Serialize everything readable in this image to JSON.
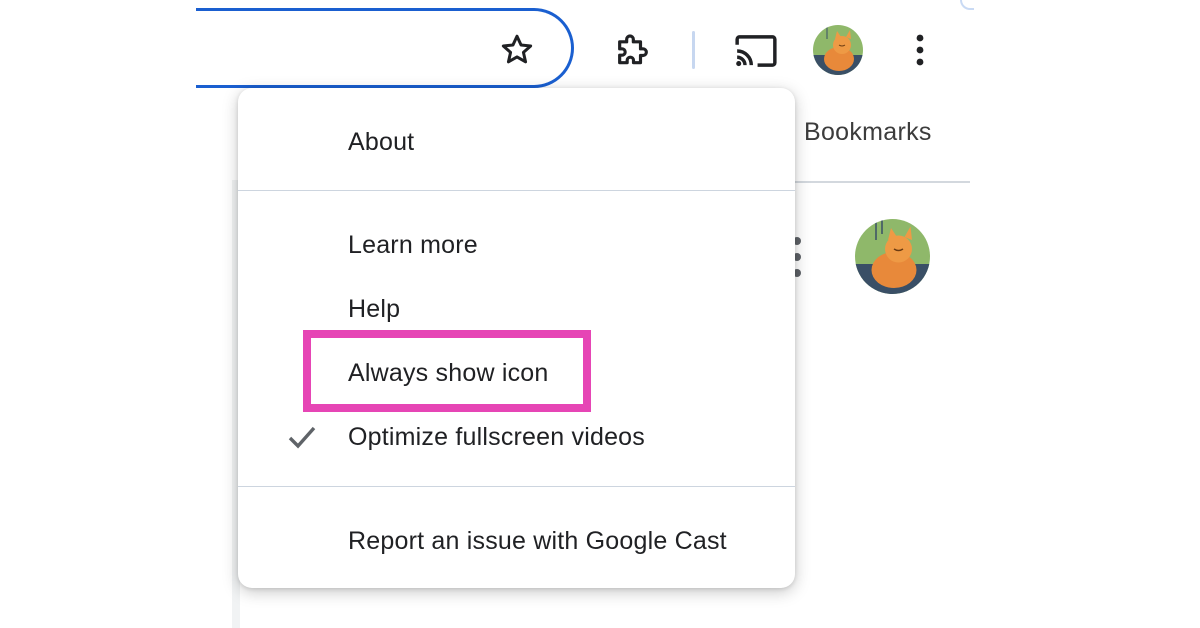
{
  "toolbar": {
    "icons": {
      "bookmark_star": "star-outline-icon",
      "extensions": "puzzle-piece-icon",
      "cast": "cast-icon",
      "profile": "profile-avatar-fox",
      "more": "three-dot-vertical-icon"
    },
    "omnibox_border_color": "#1a5fd0"
  },
  "page": {
    "bookmarks_label": "Bookmarks"
  },
  "cast_menu": {
    "items": [
      {
        "label": "About",
        "checked": false
      },
      {
        "label": "Learn more",
        "checked": false
      },
      {
        "label": "Help",
        "checked": false
      },
      {
        "label": "Always show icon",
        "checked": false,
        "highlighted": true
      },
      {
        "label": "Optimize fullscreen videos",
        "checked": true
      },
      {
        "label": "Report an issue with Google Cast",
        "checked": false
      }
    ]
  },
  "colors": {
    "highlight": "#e645b5",
    "text": "#202124",
    "check": "#5f6368"
  }
}
